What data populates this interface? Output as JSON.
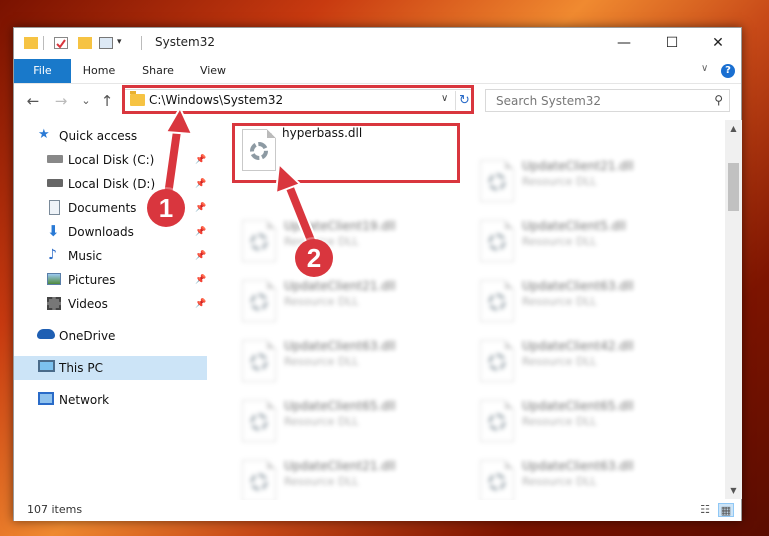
{
  "window": {
    "title": "System32",
    "controls": {
      "minimize": "—",
      "maximize": "☐",
      "close": "✕"
    }
  },
  "ribbon": {
    "tabs": [
      "File",
      "Home",
      "Share",
      "View"
    ],
    "help": "?",
    "collapse": "∨"
  },
  "nav": {
    "back": "←",
    "forward": "→",
    "recent": "⌄",
    "up": "↑",
    "address": "C:\\Windows\\System32",
    "address_chevron": "∨",
    "refresh": "↻",
    "search_placeholder": "Search System32",
    "search_icon": "⚲"
  },
  "sidebar": {
    "items": [
      {
        "label": "Quick access",
        "icon": "star-icon",
        "pinned": false
      },
      {
        "label": "Local Disk (C:)",
        "icon": "drive-icon",
        "pinned": true
      },
      {
        "label": "Local Disk (D:)",
        "icon": "drive-icon",
        "pinned": true
      },
      {
        "label": "Documents",
        "icon": "documents-icon",
        "pinned": true
      },
      {
        "label": "Downloads",
        "icon": "download-icon",
        "pinned": true
      },
      {
        "label": "Music",
        "icon": "music-icon",
        "pinned": true
      },
      {
        "label": "Pictures",
        "icon": "pictures-icon",
        "pinned": true
      },
      {
        "label": "Videos",
        "icon": "videos-icon",
        "pinned": true
      },
      {
        "label": "OneDrive",
        "icon": "cloud-icon",
        "pinned": false
      },
      {
        "label": "This PC",
        "icon": "computer-icon",
        "pinned": false,
        "selected": true
      },
      {
        "label": "Network",
        "icon": "network-icon",
        "pinned": false
      }
    ],
    "pin_glyph": "📌"
  },
  "files": {
    "highlighted": {
      "name": "hyperbass.dll"
    },
    "left_column": [
      {
        "name": "UpdateClient19.dll",
        "type": "Resource DLL"
      },
      {
        "name": "UpdateClient21.dll",
        "type": "Resource DLL"
      },
      {
        "name": "UpdateClient63.dll",
        "type": "Resource DLL"
      },
      {
        "name": "UpdateClient65.dll",
        "type": "Resource DLL"
      },
      {
        "name": "UpdateClient21.dll",
        "type": "Resource DLL"
      }
    ],
    "right_column": [
      {
        "name": "UpdateClient21.dll",
        "type": "Resource DLL"
      },
      {
        "name": "UpdateClient5.dll",
        "type": "Resource DLL"
      },
      {
        "name": "UpdateClient63.dll",
        "type": "Resource DLL"
      },
      {
        "name": "UpdateClient42.dll",
        "type": "Resource DLL"
      },
      {
        "name": "UpdateClient65.dll",
        "type": "Resource DLL"
      },
      {
        "name": "UpdateClient63.dll",
        "type": "Resource DLL"
      }
    ]
  },
  "status": {
    "item_count": "107 items",
    "details_view": "☷",
    "tiles_view": "▦"
  },
  "annotations": {
    "step1": "1",
    "step2": "2",
    "color": "#d9363e"
  }
}
